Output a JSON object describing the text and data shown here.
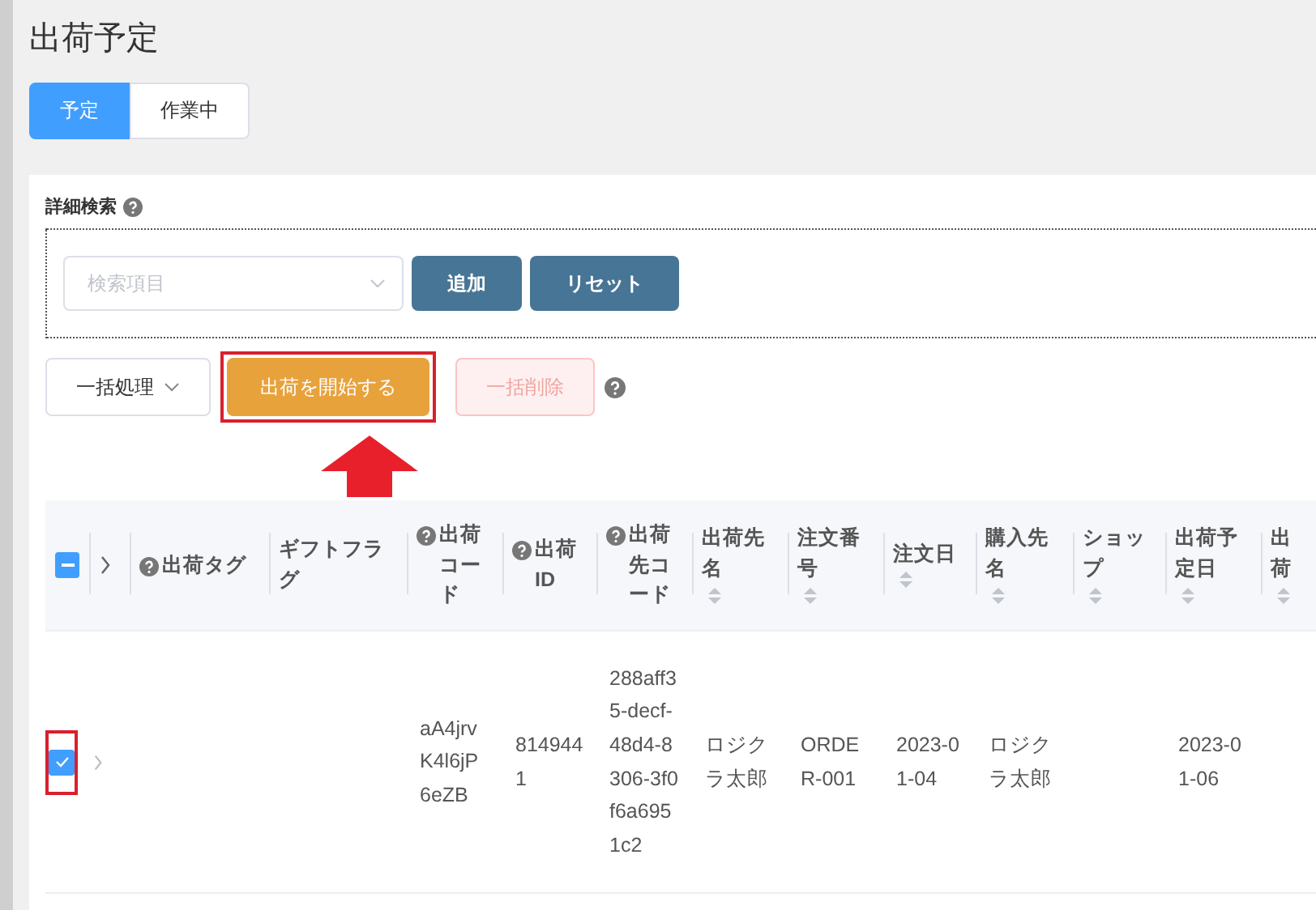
{
  "page_title": "出荷予定",
  "tabs": [
    {
      "label": "予定",
      "selected": true
    },
    {
      "label": "作業中",
      "selected": false
    }
  ],
  "search": {
    "label": "詳細検索",
    "field": {
      "placeholder": "検索項目"
    },
    "buttons": [
      "追加",
      "リセット"
    ]
  },
  "bulk": {
    "menu": "一括処理",
    "start_button": {
      "label": "出荷を開始する",
      "highlighted": true
    },
    "delete_button": {
      "label": "一括削除",
      "disabled": true
    }
  },
  "table": {
    "header_checkbox": {
      "indeterminate": true
    },
    "columns": [
      {
        "label": "出荷タグ",
        "help": true,
        "sortable": false
      },
      {
        "label": "ギフトフラグ",
        "help": false,
        "sortable": false
      },
      {
        "label": "出荷コード",
        "help": true,
        "sortable": false
      },
      {
        "label": "出荷ID",
        "help": true,
        "sortable": false
      },
      {
        "label": "出荷先コード",
        "help": true,
        "sortable": false
      },
      {
        "label": "出荷先名",
        "help": false,
        "sortable": true
      },
      {
        "label": "注文番号",
        "help": false,
        "sortable": true
      },
      {
        "label": "注文日",
        "help": false,
        "sortable": true
      },
      {
        "label": "購入先名",
        "help": false,
        "sortable": true
      },
      {
        "label": "ショップ",
        "help": false,
        "sortable": true
      },
      {
        "label": "出荷予定日",
        "help": false,
        "sortable": true
      },
      {
        "label": "出荷",
        "help": false,
        "sortable": true
      }
    ],
    "rows": [
      {
        "checked": true,
        "highlighted": true,
        "cells": [
          "",
          "",
          "aA4jrvK4l6jP6eZB",
          "8149441",
          "288aff35-decf-48d4-8306-3f0f6a6951c2",
          "ロジクラ太郎",
          "ORDER-001",
          "2023-01-04",
          "ロジクラ太郎",
          "",
          "2023-01-06",
          ""
        ]
      }
    ]
  }
}
